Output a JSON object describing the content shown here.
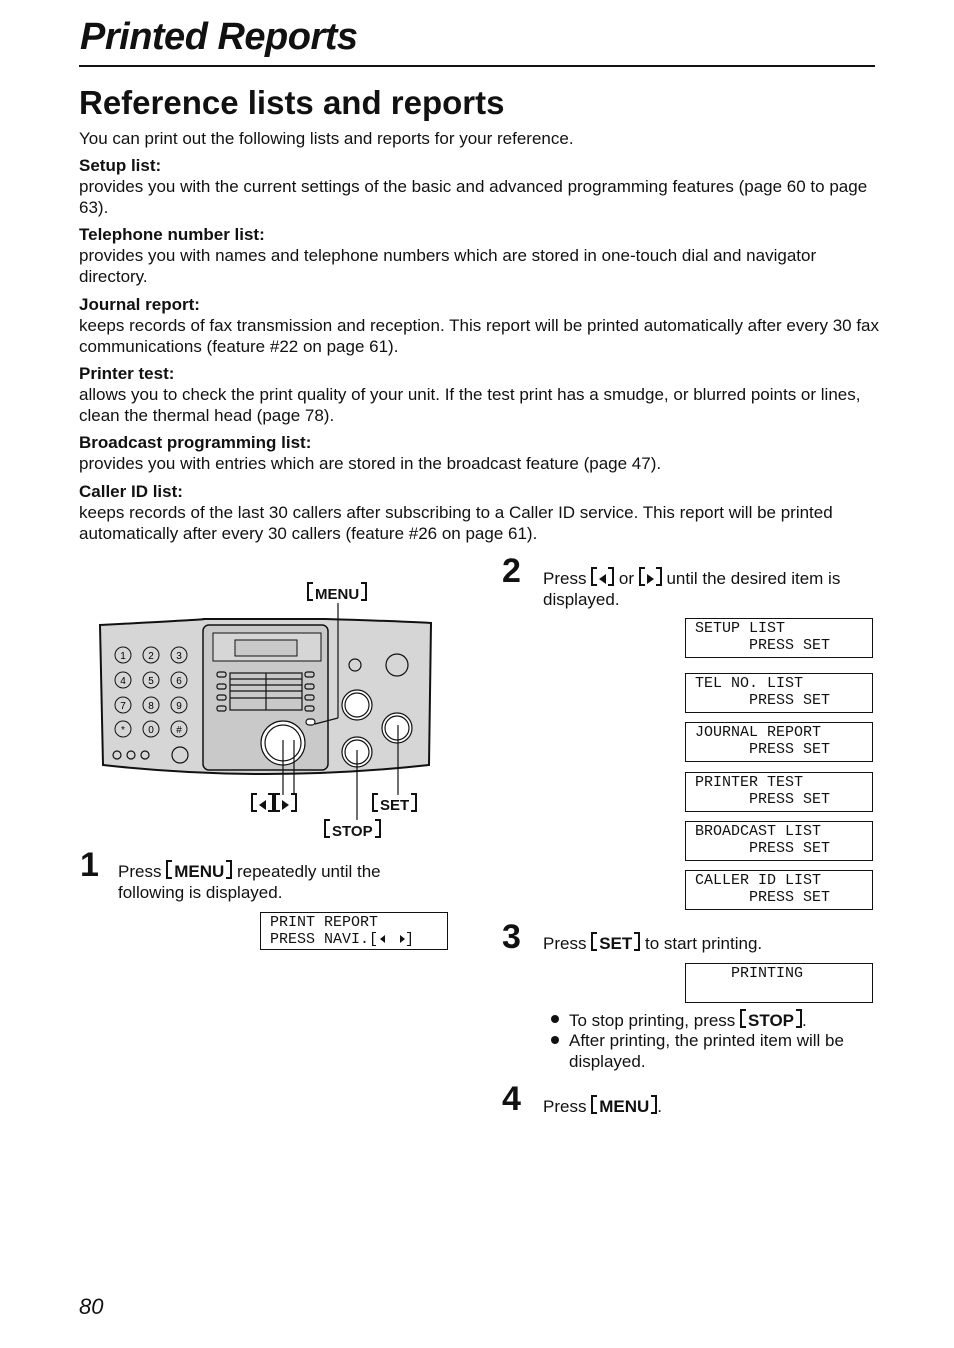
{
  "header": {
    "title": "Printed Reports"
  },
  "section": {
    "heading": "Reference lists and reports",
    "intro": "You can print out the following lists and reports for your reference."
  },
  "items": [
    {
      "term": "Setup list:",
      "desc": "provides you with the current settings of the basic and advanced programming features (page 60 to page 63)."
    },
    {
      "term": "Telephone number list:",
      "desc": "provides you with names and telephone numbers which are stored in one-touch dial and navigator directory."
    },
    {
      "term": "Journal report:",
      "desc": "keeps records of fax transmission and reception. This report will be printed automatically after every 30 fax communications (feature #22 on page 61)."
    },
    {
      "term": "Printer test:",
      "desc": "allows you to check the print quality of your unit. If the test print has a smudge, or blurred points or lines, clean the thermal head (page 78)."
    },
    {
      "term": "Broadcast programming list:",
      "desc": "provides you with entries which are stored in the broadcast feature (page 47)."
    },
    {
      "term": "Caller ID list:",
      "desc": "keeps records of the last 30 callers after subscribing to a Caller ID service. This report will be printed automatically after every 30 callers (feature #26 on page 61)."
    }
  ],
  "figure": {
    "menu": "MENU",
    "set": "SET",
    "stop": "STOP",
    "keypad": [
      "1",
      "2",
      "3",
      "4",
      "5",
      "6",
      "7",
      "8",
      "9",
      "*",
      "0",
      "#"
    ]
  },
  "steps": [
    {
      "num": "1",
      "pre": "Press ",
      "key": "MENU",
      "post": " repeatedly until the following is displayed.",
      "lcd": [
        "PRINT REPORT",
        "PRESS NAVI.["
      ]
    },
    {
      "num": "2",
      "pre": "Press ",
      "or": " or ",
      "post": " until the desired item is displayed.",
      "lcds": [
        [
          "SETUP LIST",
          "      PRESS SET"
        ],
        [
          "TEL NO. LIST",
          "      PRESS SET"
        ],
        [
          "JOURNAL REPORT",
          "      PRESS SET"
        ],
        [
          "PRINTER TEST",
          "      PRESS SET"
        ],
        [
          "BROADCAST LIST",
          "      PRESS SET"
        ],
        [
          "CALLER ID LIST",
          "      PRESS SET"
        ]
      ]
    },
    {
      "num": "3",
      "pre": "Press ",
      "key": "SET",
      "post": " to start printing.",
      "lcd": "    PRINTING",
      "bullets": [
        {
          "pre": "To stop printing, press ",
          "key": "STOP",
          "post": "."
        },
        {
          "text": "After printing, the printed item will be displayed."
        }
      ]
    },
    {
      "num": "4",
      "pre": "Press ",
      "key": "MENU",
      "post": "."
    }
  ],
  "footer": {
    "page": "80"
  }
}
